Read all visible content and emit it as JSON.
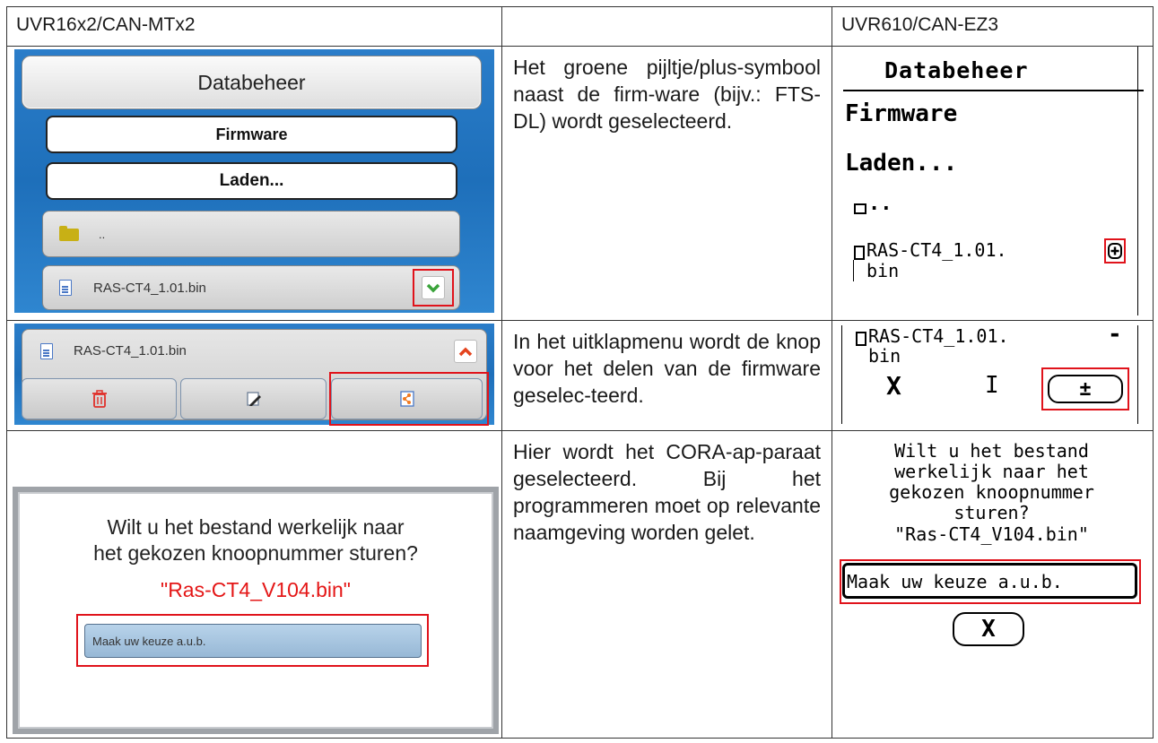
{
  "header": {
    "col1": "UVR16x2/CAN-MTx2",
    "col2": "",
    "col3": "UVR610/CAN-EZ3"
  },
  "row1": {
    "touch": {
      "title": "Databeheer",
      "firmware": "Firmware",
      "laden": "Laden...",
      "up_dots": "..",
      "file_name": "RAS-CT4_1.01.bin",
      "chevron": "⌄"
    },
    "description": "Het groene pijltje/plus-symbool naast de firm-ware (bijv.: FTS-DL) wordt geselecteerd.",
    "lcd": {
      "title": "Databeheer",
      "firmware": "Firmware",
      "laden": "Laden...",
      "up": "..",
      "file_line1": "RAS-CT4_1.01.",
      "file_line2": "bin",
      "plus": "+"
    }
  },
  "row2": {
    "touch": {
      "file_name": "RAS-CT4_1.01.bin",
      "chevron": "^"
    },
    "description": "In het uitklapmenu wordt de knop voor het delen van de firmware geselec-teerd.",
    "lcd": {
      "file_line1": "RAS-CT4_1.01.",
      "file_line2": "bin",
      "minus": "-",
      "delete": "X",
      "rename": "I",
      "share": "±"
    }
  },
  "row3": {
    "dialog": {
      "question_line1": "Wilt u het bestand werkelijk naar",
      "question_line2": "het gekozen knoopnummer sturen?",
      "file": "\"Ras-CT4_V104.bin\"",
      "select": "Maak uw keuze a.u.b."
    },
    "description": "Hier wordt het CORA-ap-paraat geselecteerd. Bij het programmeren moet op relevante naamgeving worden gelet.",
    "lcd": {
      "line1": "Wilt u het bestand",
      "line2": "werkelijk naar het",
      "line3": "gekozen knoopnummer",
      "line4": "sturen?",
      "file": "\"Ras-CT4_V104.bin\"",
      "select": "Maak uw keuze a.u.b.",
      "cancel": "X"
    }
  },
  "colors": {
    "highlight": "#e0131b",
    "touch_bg": "#1e6fba",
    "dialog_file": "#e41616",
    "chevron_down": "#3aa33a",
    "chevron_up": "#e4441e"
  }
}
